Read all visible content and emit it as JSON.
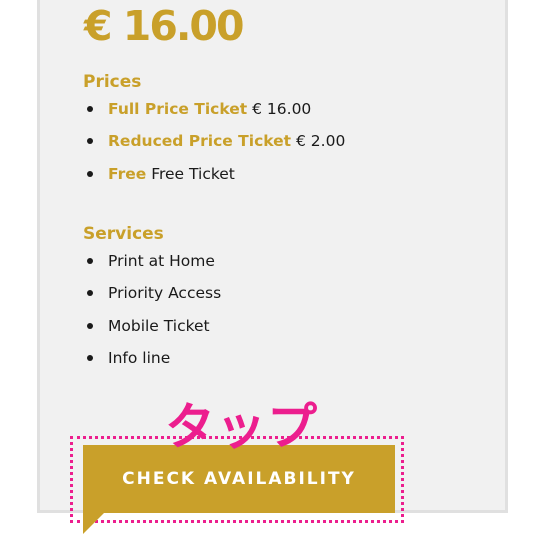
{
  "price": {
    "display": "€ 16.00"
  },
  "prices": {
    "title": "Prices",
    "items": [
      {
        "name": "Full Price Ticket",
        "value": "€ 16.00"
      },
      {
        "name": "Reduced Price Ticket",
        "value": "€ 2.00"
      },
      {
        "name": "Free",
        "value": "Free Ticket"
      }
    ]
  },
  "services": {
    "title": "Services",
    "items": [
      {
        "label": "Print at Home"
      },
      {
        "label": "Priority Access"
      },
      {
        "label": "Mobile Ticket"
      },
      {
        "label": "Info line"
      }
    ]
  },
  "annotation": {
    "tap_label": "タップ",
    "color": "#ec1e8e"
  },
  "cta": {
    "label": "CHECK AVAILABILITY",
    "color": "#c9a02a"
  }
}
